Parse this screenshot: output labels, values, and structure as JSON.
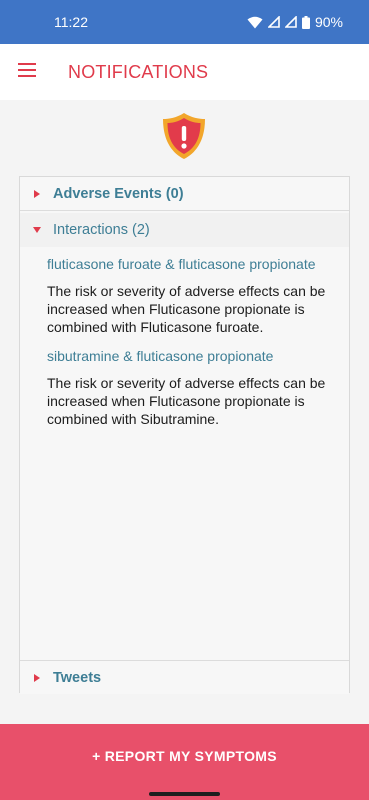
{
  "status_bar": {
    "time": "11:22",
    "battery": "90%",
    "icons": [
      "wifi-icon",
      "signal-icon",
      "signal-icon",
      "battery-icon"
    ]
  },
  "app_bar": {
    "title": "NOTIFICATIONS",
    "menu_icon": "hamburger-menu-icon"
  },
  "header_icon": "warning-shield-icon",
  "sections": {
    "adverse_events": {
      "label": "Adverse Events (0)",
      "expanded": false
    },
    "interactions": {
      "label": "Interactions (2)",
      "expanded": true,
      "items": [
        {
          "title": "fluticasone furoate & fluticasone propionate",
          "description": "The risk or severity of adverse effects can be increased when Fluticasone propionate is combined with Fluticasone furoate."
        },
        {
          "title": "sibutramine & fluticasone propionate",
          "description": "The risk or severity of adverse effects can be increased when Fluticasone propionate is combined with Sibutramine."
        }
      ]
    },
    "tweets": {
      "label": "Tweets",
      "expanded": false
    }
  },
  "report_button": {
    "label": "+ REPORT MY SYMPTOMS"
  },
  "colors": {
    "status_bar": "#3f75c6",
    "accent_red": "#e03b4b",
    "link_teal": "#3e7e95",
    "button_pink": "#e8506a"
  }
}
